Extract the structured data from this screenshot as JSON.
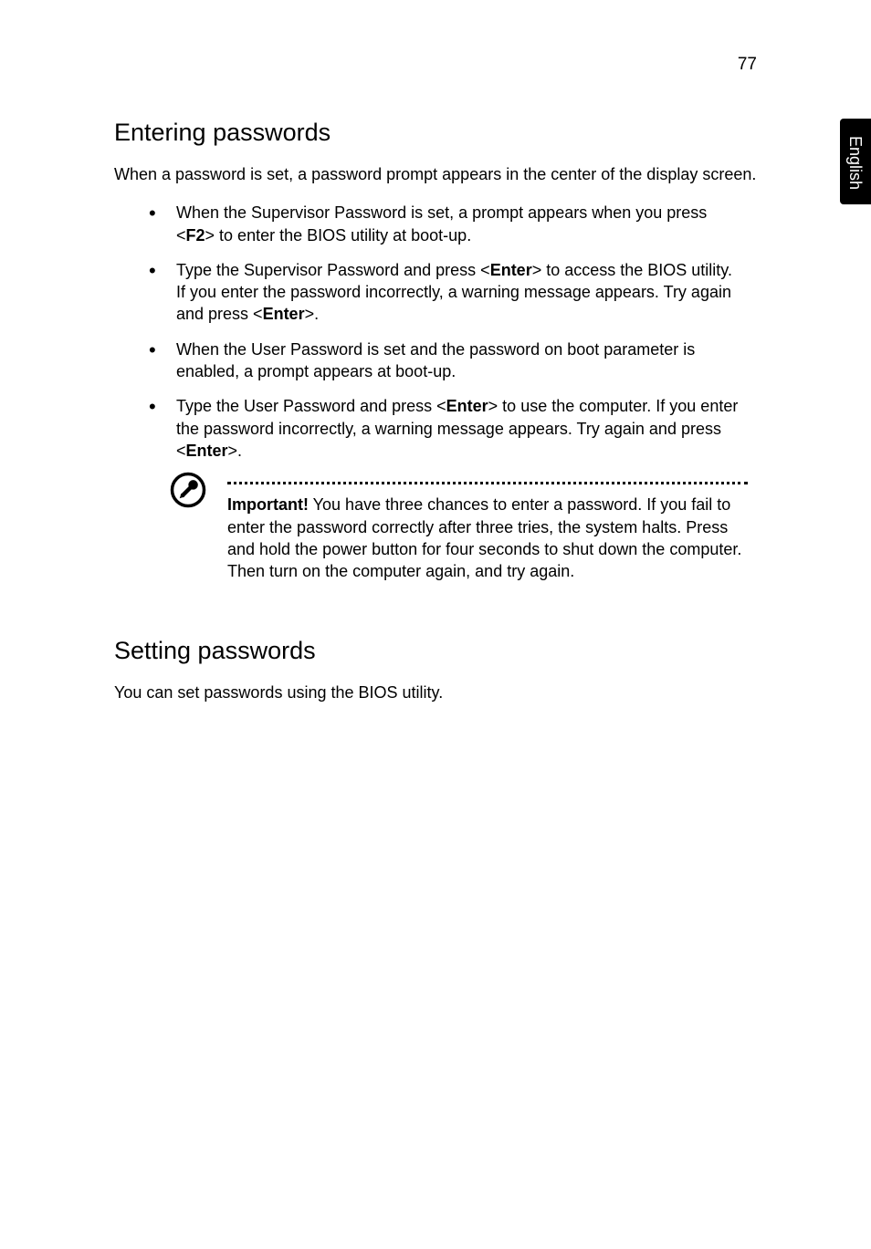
{
  "pageNumber": "77",
  "languageTab": "English",
  "section1": {
    "heading": "Entering passwords",
    "intro": "When a password is set, a password prompt appears in the center of the display screen.",
    "bullets": [
      {
        "pre": "When the Supervisor Password is set, a prompt appears when you press <",
        "k1": "F2",
        "post": "> to enter the BIOS utility at boot-up."
      },
      {
        "pre": "Type the Supervisor Password and press <",
        "k1": "Enter",
        "mid": "> to access the BIOS utility. If you enter the password incorrectly, a warning message appears. Try again and press <",
        "k2": "Enter",
        "post": ">."
      },
      {
        "pre": "When the User Password is set and the password on boot parameter is enabled, a prompt appears at boot-up."
      },
      {
        "pre": "Type the User Password and press <",
        "k1": "Enter",
        "mid": "> to use the computer. If you enter the password incorrectly, a warning message appears. Try again and press <",
        "k2": "Enter",
        "post": ">."
      }
    ],
    "callout": {
      "label": "Important!",
      "body": " You have three chances to enter a password. If you fail to enter the password correctly after three tries, the system halts. Press and hold the power button for four seconds to shut down the computer. Then turn on the computer again, and try again."
    }
  },
  "section2": {
    "heading": "Setting passwords",
    "intro": "You can set passwords using the BIOS utility."
  }
}
